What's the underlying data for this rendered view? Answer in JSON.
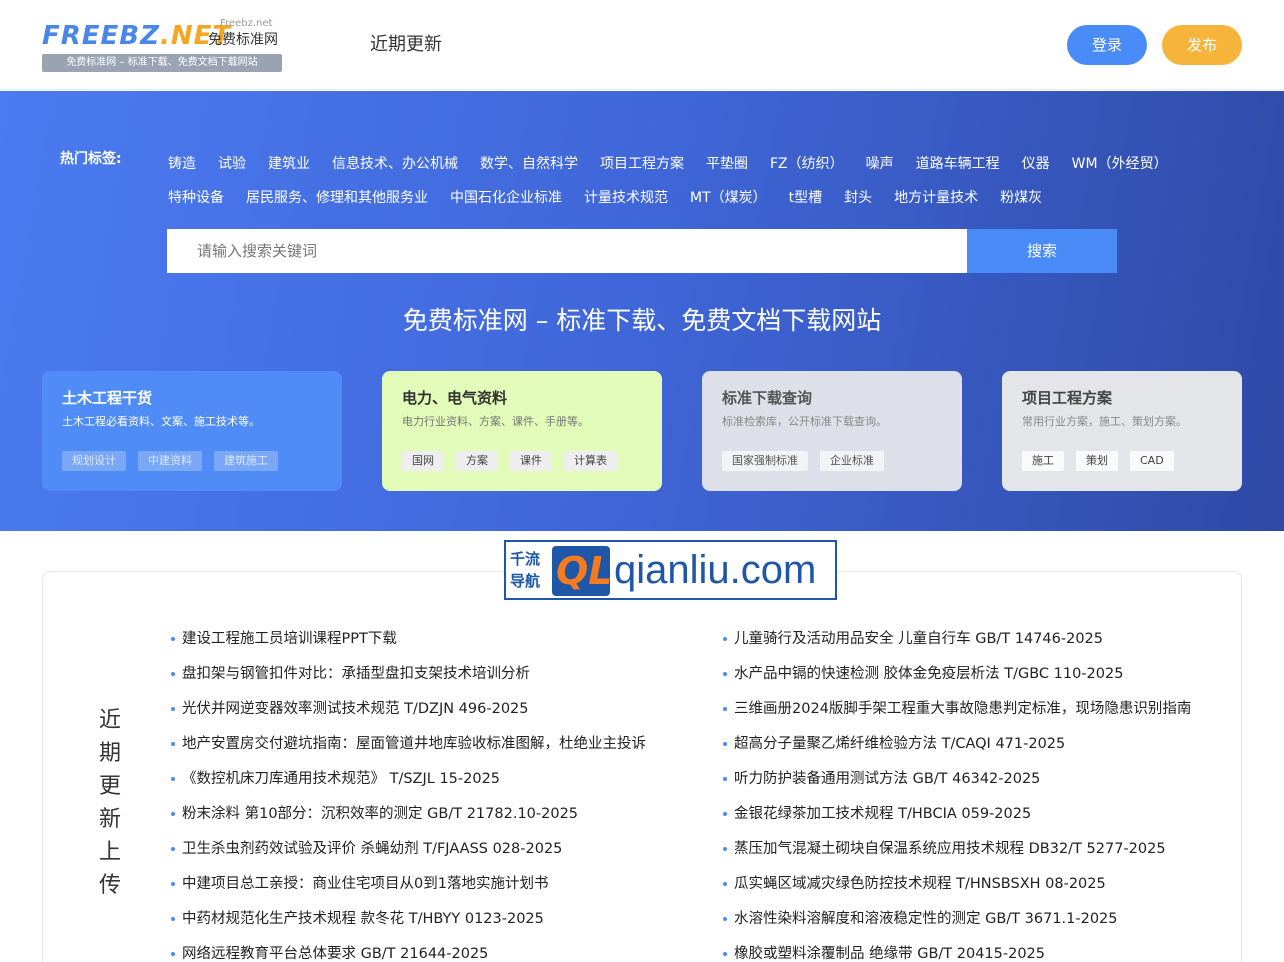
{
  "header": {
    "logo_main": "FREEBZ",
    "logo_dot": ".NET",
    "logo_small": "Freebz.net",
    "logo_cn": "免费标准网",
    "logo_tagline": "免费标准网 – 标准下载、免费文档下载网站",
    "nav_recent": "近期更新",
    "login": "登录",
    "publish": "发布"
  },
  "hero": {
    "tags_label": "热门标签:",
    "tags_row1": [
      "铸造",
      "试验",
      "建筑业",
      "信息技术、办公机械",
      "数学、自然科学",
      "项目工程方案",
      "平垫圈",
      "FZ（纺织）",
      "噪声",
      "道路车辆工程",
      "仪器",
      "WM（外经贸）"
    ],
    "tags_row2": [
      "特种设备",
      "居民服务、修理和其他服务业",
      "中国石化企业标准",
      "计量技术规范",
      "MT（煤炭）",
      "t型槽",
      "封头",
      "地方计量技术",
      "粉煤灰"
    ],
    "search_placeholder": "请输入搜索关键词",
    "search_button": "搜索",
    "title": "免费标准网 – 标准下载、免费文档下载网站"
  },
  "cards": [
    {
      "title": "土木工程干货",
      "desc": "土木工程必看资料、文案、施工技术等。",
      "chips": [
        "规划设计",
        "中建资料",
        "建筑施工"
      ]
    },
    {
      "title": "电力、电气资料",
      "desc": "电力行业资料、方案、课件、手册等。",
      "chips": [
        "国网",
        "方案",
        "课件",
        "计算表"
      ]
    },
    {
      "title": "标准下载查询",
      "desc": "标准检索库，公开标准下载查询。",
      "chips": [
        "国家强制标准",
        "企业标准"
      ]
    },
    {
      "title": "项目工程方案",
      "desc": "常用行业方案，施工、策划方案。",
      "chips": [
        "施工",
        "策划",
        "CAD"
      ]
    }
  ],
  "banner": {
    "cn_line1": "千流",
    "cn_line2": "导航",
    "ql": "QL",
    "domain": "qianliu.com"
  },
  "recent": {
    "side_title": [
      "近",
      "期",
      "更",
      "新",
      "上",
      "传"
    ],
    "left": [
      "建设工程施工员培训课程PPT下载",
      "盘扣架与钢管扣件对比：承插型盘扣支架技术培训分析",
      "光伏并网逆变器效率测试技术规范 T/DZJN 496-2025",
      "地产安置房交付避坑指南：屋面管道井地库验收标准图解，杜绝业主投诉",
      "《数控机床刀库通用技术规范》 T/SZJL 15-2025",
      "粉末涂料 第10部分：沉积效率的测定 GB/T 21782.10-2025",
      "卫生杀虫剂药效试验及评价 杀蝇幼剂 T/FJAASS 028-2025",
      "中建项目总工亲授：商业住宅项目从0到1落地实施计划书",
      "中药材规范化生产技术规程 款冬花 T/HBYY 0123-2025",
      "网络远程教育平台总体要求 GB/T 21644-2025"
    ],
    "right": [
      "儿童骑行及活动用品安全 儿童自行车 GB/T 14746-2025",
      "水产品中镉的快速检测 胶体金免疫层析法 T/GBC 110-2025",
      "三维画册2024版脚手架工程重大事故隐患判定标准，现场隐患识别指南",
      "超高分子量聚乙烯纤维检验方法 T/CAQI 471-2025",
      "听力防护装备通用测试方法 GB/T 46342-2025",
      "金银花绿茶加工技术规程 T/HBCIA 059-2025",
      "蒸压加气混凝土砌块自保温系统应用技术规程 DB32/T 5277-2025",
      "瓜实蝇区域减灾绿色防控技术规程 T/HNSBSXH 08-2025",
      "水溶性染料溶解度和溶液稳定性的测定 GB/T 3671.1-2025",
      "橡胶或塑料涂覆制品 绝缘带 GB/T 20415-2025"
    ]
  },
  "colors": {
    "accent": "#4a8cf7",
    "publish": "#f6b43a",
    "hero_start": "#4b7bf0",
    "hero_end": "#2f4aa6"
  }
}
